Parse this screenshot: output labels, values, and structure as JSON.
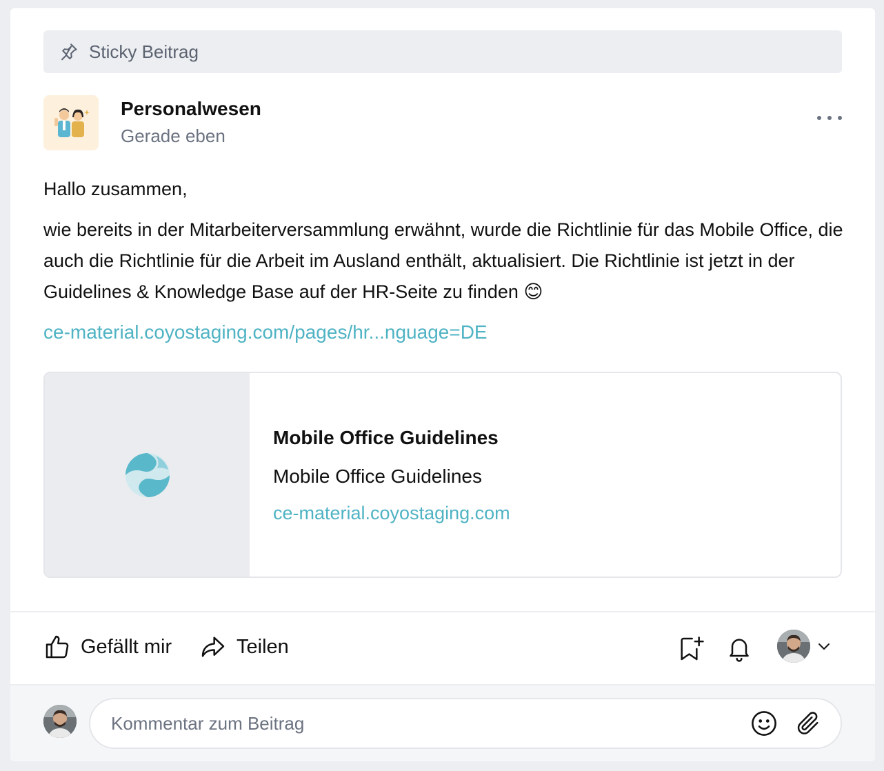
{
  "sticky": {
    "label": "Sticky Beitrag"
  },
  "post": {
    "author": "Personalwesen",
    "time": "Gerade eben",
    "greeting": "Hallo zusammen,",
    "body": "wie bereits in der Mitarbeiterversammlung erwähnt, wurde die Richtlinie für das Mobile Office, die auch die Richtlinie für die Arbeit im Ausland enthält, aktualisiert. Die Richtlinie ist jetzt in der Guidelines & Knowledge Base auf der HR-Seite zu finden 😊",
    "link_text": "ce-material.coyostaging.com/pages/hr...nguage=DE"
  },
  "preview": {
    "title": "Mobile Office Guidelines",
    "description": "Mobile Office Guidelines",
    "url": "ce-material.coyostaging.com"
  },
  "actions": {
    "like_label": "Gefällt mir",
    "share_label": "Teilen"
  },
  "comment": {
    "placeholder": "Kommentar zum Beitrag"
  },
  "colors": {
    "accent": "#4fb3c4",
    "muted_text": "#6b7280",
    "page_bg": "#eceef1"
  },
  "icons": [
    "pin-icon",
    "more-icon",
    "like-icon",
    "share-icon",
    "bookmark-add-icon",
    "bell-icon",
    "chevron-down-icon",
    "emoji-icon",
    "attachment-icon",
    "coyo-logo"
  ]
}
